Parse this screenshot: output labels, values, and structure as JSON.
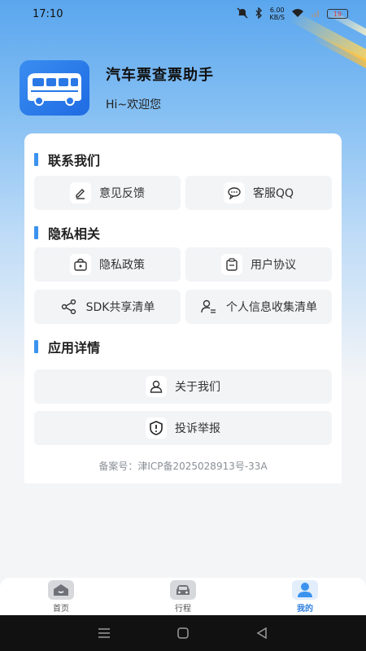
{
  "status_bar": {
    "time": "17:10",
    "speed": "6.00",
    "speed_unit": "KB/S",
    "battery": "19"
  },
  "app": {
    "title": "汽车票查票助手",
    "greeting": "Hi~欢迎您"
  },
  "sections": {
    "contact": {
      "title": "联系我们",
      "feedback": "意见反馈",
      "service_qq": "客服QQ"
    },
    "privacy": {
      "title": "隐私相关",
      "policy": "隐私政策",
      "agreement": "用户协议",
      "sdk_list": "SDK共享清单",
      "personal_info": "个人信息收集清单"
    },
    "app_details": {
      "title": "应用详情",
      "about": "关于我们",
      "report": "投诉举报"
    }
  },
  "filing": "备案号：津ICP备2025028913号-33A",
  "tabs": [
    {
      "label": "首页",
      "icon": "home-icon"
    },
    {
      "label": "行程",
      "icon": "car-icon"
    },
    {
      "label": "我的",
      "icon": "person-icon"
    }
  ],
  "colors": {
    "accent": "#3b93ee",
    "active_tab": "#2f7fe0",
    "battery_low": "#e23a3a"
  }
}
